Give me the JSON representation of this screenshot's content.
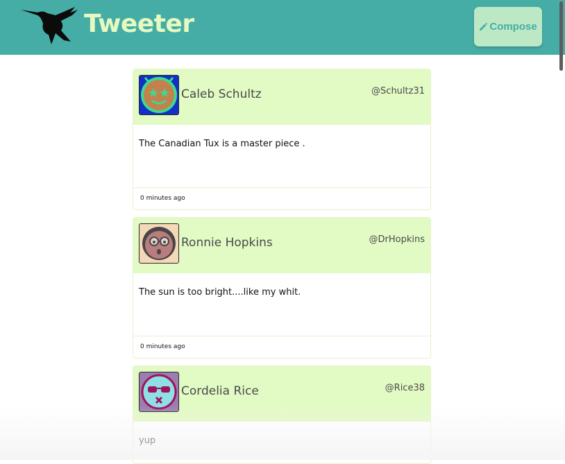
{
  "header": {
    "brand": "Tweeter",
    "compose_label": "Compose",
    "logo_icon": "hummingbird-icon",
    "compose_icon": "pencil-icon"
  },
  "colors": {
    "nav_background": "#45ada5",
    "brand_text": "#e6f9c1",
    "compose_background": "#bde8c5",
    "tweet_header_background": "#e2fac3"
  },
  "tweets": [
    {
      "name": "Caleb Schultz",
      "handle": "@Schultz31",
      "text": "The Canadian Tux is a master piece .",
      "timestamp": "0 minutes ago",
      "avatar_icon": "smiley-star-eyes-avatar"
    },
    {
      "name": "Ronnie Hopkins",
      "handle": "@DrHopkins",
      "text": "The sun is too bright....like my whit.",
      "timestamp": "0 minutes ago",
      "avatar_icon": "glasses-face-avatar"
    },
    {
      "name": "Cordelia Rice",
      "handle": "@Rice38",
      "text": "yup",
      "timestamp": "",
      "avatar_icon": "sunglasses-face-avatar"
    }
  ]
}
